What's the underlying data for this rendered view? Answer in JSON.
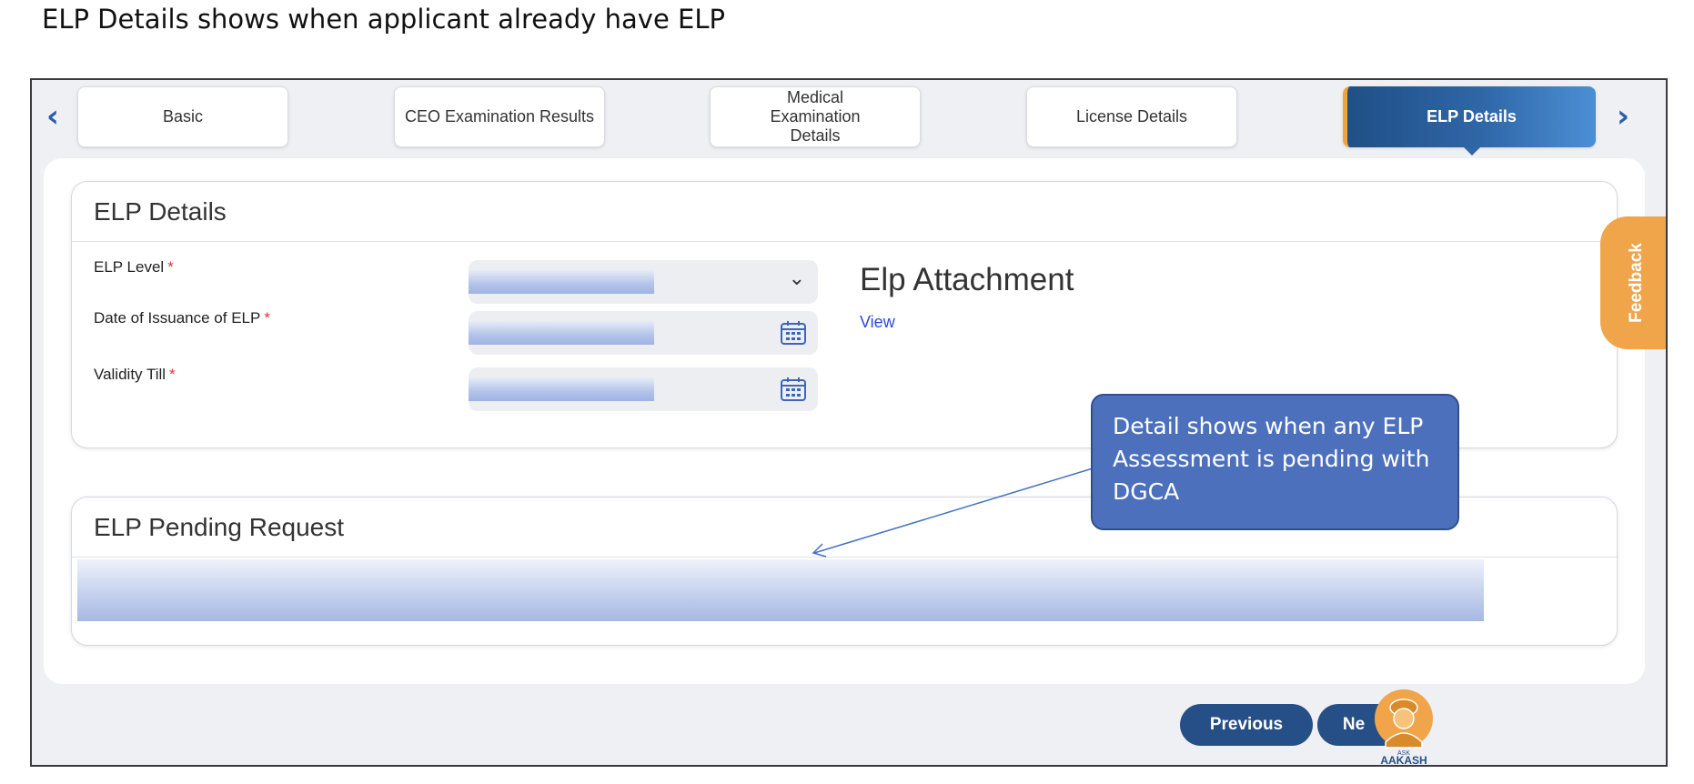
{
  "caption": "ELP Details shows when applicant already have ELP",
  "tabs": [
    {
      "label": "Basic"
    },
    {
      "label": "CEO Examination Results"
    },
    {
      "label": "Medical Examination Details"
    },
    {
      "label": "License Details"
    },
    {
      "label": "ELP Details",
      "active": true
    }
  ],
  "elp_card": {
    "title": "ELP Details",
    "fields": {
      "level": {
        "label": "ELP Level",
        "required_mark": "*"
      },
      "issue_date": {
        "label": "Date of Issuance of ELP",
        "required_mark": "*"
      },
      "validity": {
        "label": "Validity Till",
        "required_mark": "*"
      }
    },
    "attachment": {
      "title": "Elp Attachment",
      "link": "View"
    }
  },
  "pending_card": {
    "title": "ELP Pending Request"
  },
  "feedback": {
    "label": "Feedback"
  },
  "callout": {
    "text": "Detail shows when any ELP Assessment is pending with DGCA"
  },
  "buttons": {
    "previous": "Previous",
    "next": "Ne"
  },
  "mascot": {
    "label_top": "ASK",
    "label_bottom": "AAKASH"
  },
  "colors": {
    "accent_blue": "#254f86",
    "active_tab_start": "#1f4f86",
    "active_tab_end": "#4b8fd4",
    "feedback_orange": "#f0a54a",
    "callout_fill": "#4d70bd",
    "required_red": "#e0342f",
    "link_blue": "#2b4bd8"
  }
}
